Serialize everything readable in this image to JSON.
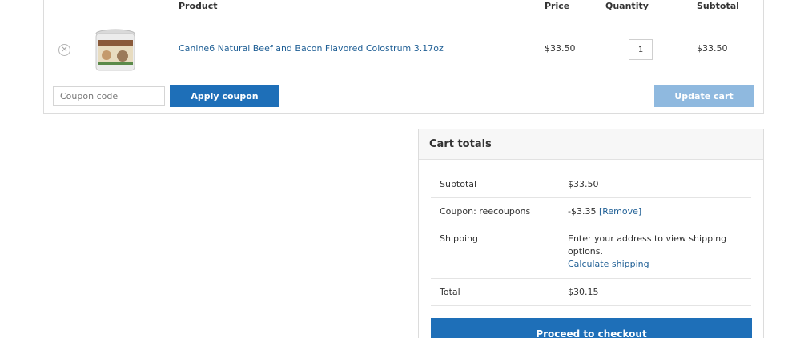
{
  "cart": {
    "headers": {
      "product": "Product",
      "price": "Price",
      "quantity": "Quantity",
      "subtotal": "Subtotal"
    },
    "item": {
      "remove_icon": "remove-circle-icon",
      "remove_glyph": "✕",
      "name": "Canine6 Natural Beef and Bacon Flavored Colostrum 3.17oz",
      "price": "$33.50",
      "quantity": "1",
      "subtotal": "$33.50"
    },
    "coupon_placeholder": "Coupon code",
    "apply_coupon_label": "Apply coupon",
    "update_cart_label": "Update cart"
  },
  "totals": {
    "title": "Cart totals",
    "subtotal_label": "Subtotal",
    "subtotal_value": "$33.50",
    "coupon_label": "Coupon: reecoupons",
    "coupon_value": "-$3.35",
    "coupon_remove": "[Remove]",
    "shipping_label": "Shipping",
    "shipping_text": "Enter your address to view shipping options.",
    "shipping_link": "Calculate shipping",
    "total_label": "Total",
    "total_value": "$30.15",
    "checkout_label": "Proceed to checkout"
  },
  "colors": {
    "primary_button": "#1e6fb8",
    "disabled_button": "#8fb9df",
    "link": "#1f5f95"
  }
}
